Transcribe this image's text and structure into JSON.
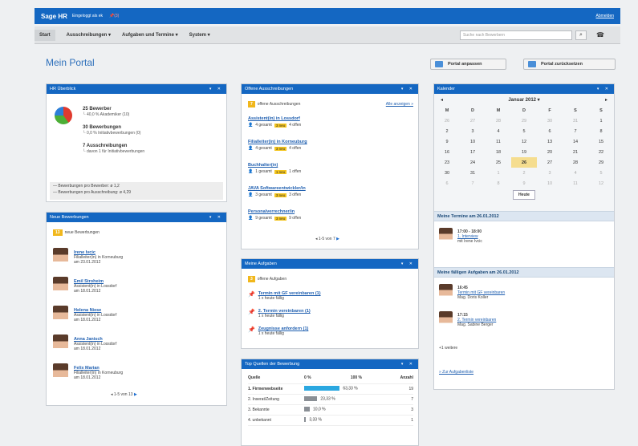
{
  "topbar": {
    "brand": "Sage HR",
    "user": "Eingeloggt als ek",
    "pin": "(3)",
    "logout": "Abmelden"
  },
  "menu": {
    "items": [
      "Start",
      "Ausschreibungen ▾",
      "Aufgaben und Termine ▾",
      "System ▾"
    ],
    "search_placeholder": "Suche nach Bewerbern"
  },
  "page": {
    "title": "Mein Portal",
    "btn_customize": "Portal anpassen",
    "btn_reset": "Portal zurücksetzen"
  },
  "hr": {
    "title": "HR Überblick",
    "bewerber": "25 Bewerber",
    "bewerber_sub": "40,0 % Akademiker (10)",
    "bewerbungen": "30 Bewerbungen",
    "bewerbungen_sub": "0,0 % Initiativbewerbungen (0)",
    "ausschr": "7 Ausschreibungen",
    "ausschr_sub": "davon 1 für Initiativbewerbungen",
    "avg1": "Bewerbungen pro Bewerber: ø 1,2",
    "avg2": "Bewerbungen pro Ausschreibung: ø 4,29"
  },
  "neu": {
    "title": "Neue Bewerbungen",
    "count": "13",
    "label": "neue Bewerbungen",
    "pager": "1-5 von 13",
    "items": [
      {
        "name": "Irene Ivcic",
        "job": "Filialleiter(in) in Korneuburg",
        "date": "am 23.01.2012"
      },
      {
        "name": "Emil Stroheim",
        "job": "Assistent(in) in Lossdorf",
        "date": "am 18.01.2012"
      },
      {
        "name": "Helena Niese",
        "job": "Assistent(in) in Lossdorf",
        "date": "am 18.01.2012"
      },
      {
        "name": "Anna Janisch",
        "job": "Assistent(in) in Lossdorf",
        "date": "am 18.01.2012"
      },
      {
        "name": "Felix Marian",
        "job": "Filialleiter(in) in Korneuburg",
        "date": "am 18.01.2012"
      }
    ]
  },
  "offen": {
    "title": "Offene Ausschreibungen",
    "count": "7",
    "label": "offene Ausschreibungen",
    "all": "Alle anzeigen »",
    "pager": "1-5 von 7",
    "items": [
      {
        "name": "Assistent(in) in Lossdorf",
        "g": "4 gesamt",
        "n": "3 neu",
        "o": "4 offen"
      },
      {
        "name": "Filialleiter(in) in Korneuburg",
        "g": "4 gesamt",
        "n": "3 neu",
        "o": "4 offen"
      },
      {
        "name": "Buchhalter(in)",
        "g": "1 gesamt",
        "n": "1 neu",
        "o": "1 offen"
      },
      {
        "name": "JAVA Softwareentwickler/in",
        "g": "3 gesamt",
        "n": "3 neu",
        "o": "3 offen"
      },
      {
        "name": "Personalverrechner/in",
        "g": "9 gesamt",
        "n": "3 neu",
        "o": "9 offen"
      }
    ]
  },
  "aufg": {
    "title": "Meine Aufgaben",
    "count": "3",
    "label": "offene Aufgaben",
    "items": [
      {
        "name": "Termin mit GF vereinbaren (1)",
        "sub": "1 x heute fällig"
      },
      {
        "name": "2. Termin vereinbaren (1)",
        "sub": "1 x heute fällig"
      },
      {
        "name": "Zeugnisse anfordern (1)",
        "sub": "1 x heute fällig"
      }
    ]
  },
  "quellen": {
    "title": "Top Quellen der Bewerbung",
    "h_quelle": "Quelle",
    "h_0": "0 %",
    "h_100": "100 %",
    "h_anzahl": "Anzahl",
    "rows": [
      {
        "name": "1. Firmenwebseite",
        "pct": "63,33 %",
        "n": "19",
        "frac": 0.6333,
        "color": "#2aa7e0"
      },
      {
        "name": "2. Inserat/Zeitung",
        "pct": "23,33 %",
        "n": "7",
        "frac": 0.2333,
        "color": "#8a8f95"
      },
      {
        "name": "3. Bekannte",
        "pct": "10,0 %",
        "n": "3",
        "frac": 0.1,
        "color": "#8a8f95"
      },
      {
        "name": "4. unbekannt",
        "pct": "3,33 %",
        "n": "1",
        "frac": 0.0333,
        "color": "#8a8f95"
      }
    ]
  },
  "kal": {
    "title": "Kalender",
    "month": "Januar 2012 ▾",
    "prev": "◂",
    "next": "▸",
    "days": [
      "M",
      "D",
      "M",
      "D",
      "F",
      "S",
      "S"
    ],
    "weeks": [
      [
        "26",
        "27",
        "28",
        "29",
        "30",
        "31",
        "1"
      ],
      [
        "2",
        "3",
        "4",
        "5",
        "6",
        "7",
        "8"
      ],
      [
        "9",
        "10",
        "11",
        "12",
        "13",
        "14",
        "15"
      ],
      [
        "16",
        "17",
        "18",
        "19",
        "20",
        "21",
        "22"
      ],
      [
        "23",
        "24",
        "25",
        "26",
        "27",
        "28",
        "29"
      ],
      [
        "30",
        "31",
        "1",
        "2",
        "3",
        "4",
        "5"
      ],
      [
        "6",
        "7",
        "8",
        "9",
        "10",
        "11",
        "12"
      ]
    ],
    "today": "Heute",
    "termine_head": "Meine Termine am 26.01.2012",
    "t_time": "17:00 - 18:00",
    "t_title": "1. Interview",
    "t_with": "mit Irene Ivcic",
    "faellig_head": "Meine fälligen Aufgaben am 26.01.2012",
    "f1_time": "16:45",
    "f1_title": "Termin mit GF vereinbaren",
    "f1_who": "Mag. Doris Koller",
    "f2_time": "17:15",
    "f2_title": "2. Termin vereinbaren",
    "f2_who": "Mag. Sabine Berger",
    "more": "+1 weitere",
    "link": "» Zur Aufgabenliste"
  },
  "colors": {
    "header": "#1467c2",
    "accent": "#f1b71c",
    "link": "#1f5fb0"
  }
}
